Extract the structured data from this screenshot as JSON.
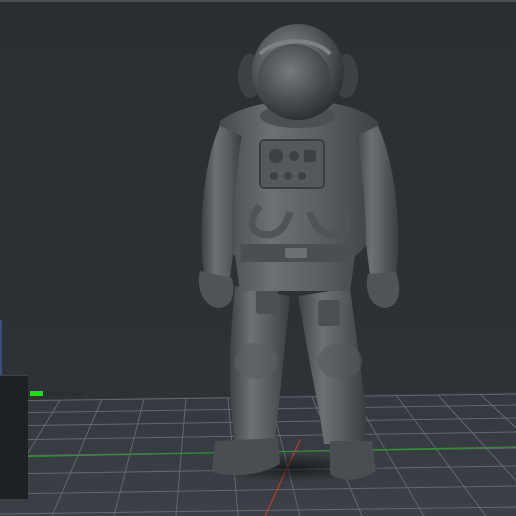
{
  "viewport": {
    "background": "#2b3034",
    "plate_grid": "on",
    "axis_colors": {
      "x": "#c03a2b",
      "y": "#2f8f2f"
    }
  },
  "model": {
    "name_icon": "astronaut-model"
  },
  "load_progress": {
    "fraction": 0.25,
    "color": "#18e21a"
  }
}
